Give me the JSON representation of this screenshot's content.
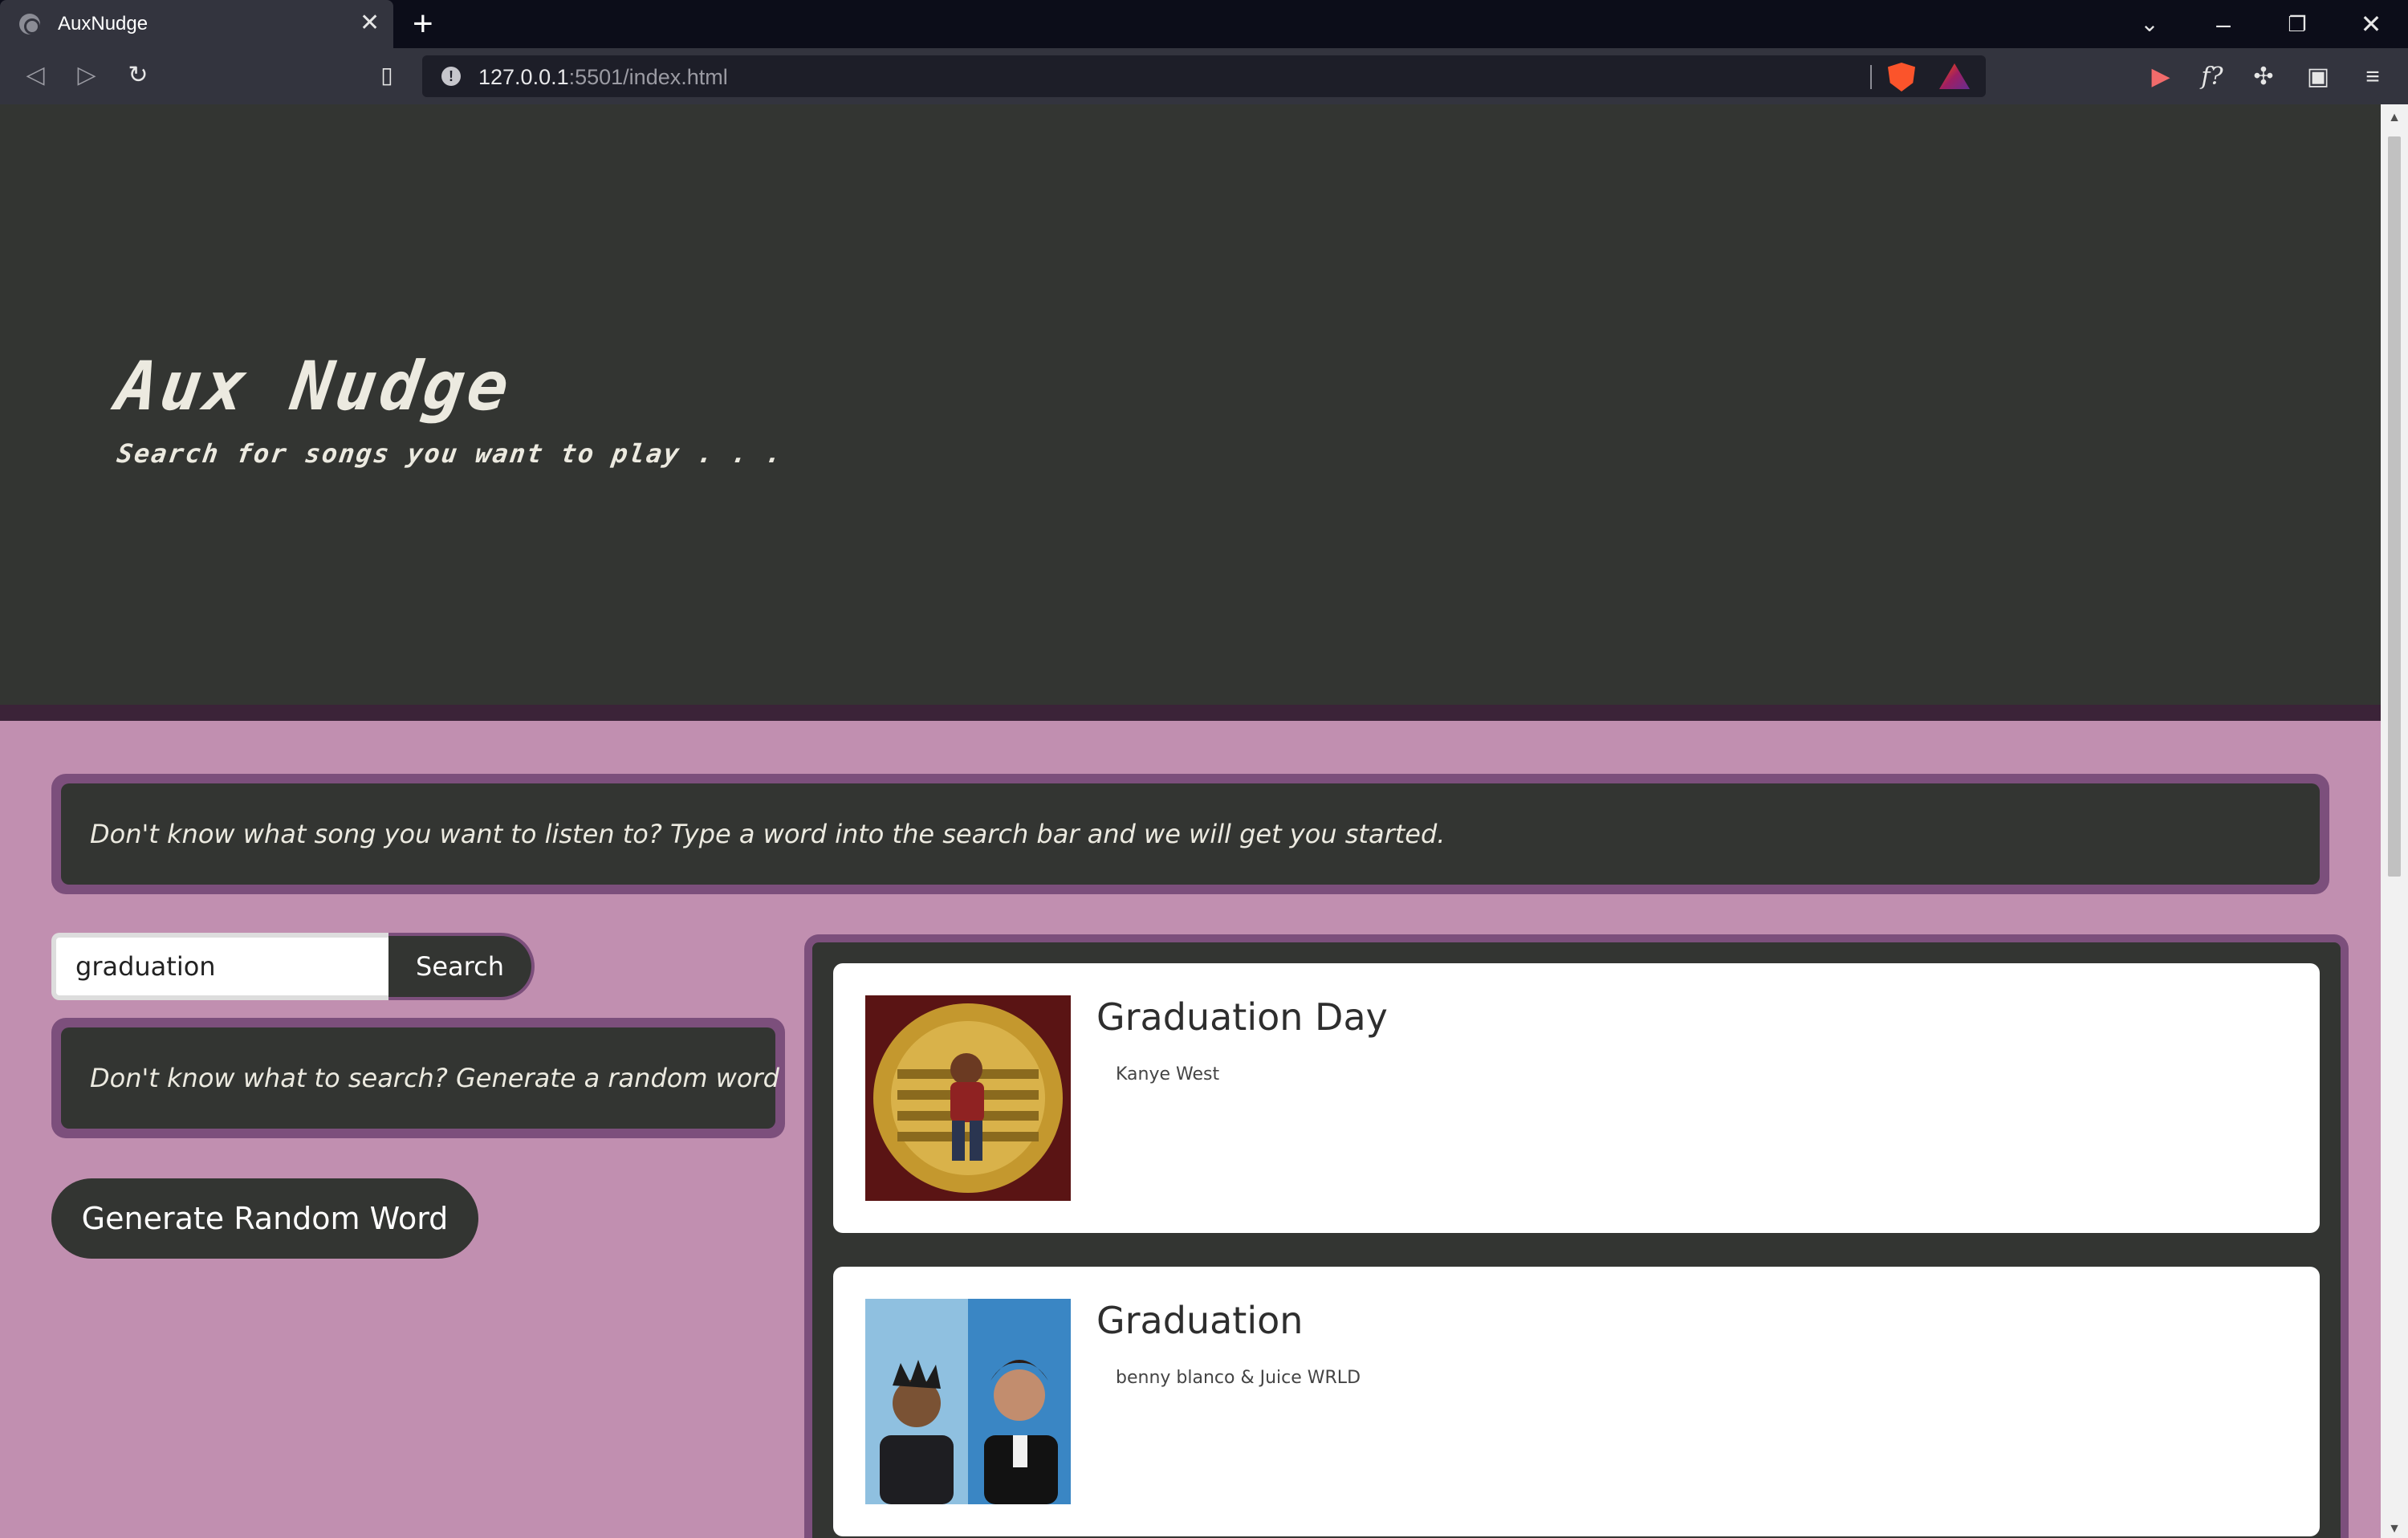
{
  "browser": {
    "tab_title": "AuxNudge",
    "url_host": "127.0.0.1",
    "url_rest": ":5501/index.html"
  },
  "hero": {
    "title": "Aux Nudge",
    "subtitle": "Search for songs you want to play . . ."
  },
  "prompt": {
    "text": "Don't know what song you want to listen to? Type a word into the search bar and we will get you started."
  },
  "search": {
    "value": "graduation",
    "button_label": "Search"
  },
  "random": {
    "text": "Don't know what to search? Generate a random word",
    "button_label": "Generate Random Word"
  },
  "results": [
    {
      "title": "Graduation Day",
      "artist": "Kanye West"
    },
    {
      "title": "Graduation",
      "artist": "benny blanco & Juice WRLD"
    }
  ],
  "colors": {
    "page_bg": "#c18fb0",
    "panel_dark": "#333532",
    "accent_purple": "#7c4f7c"
  }
}
